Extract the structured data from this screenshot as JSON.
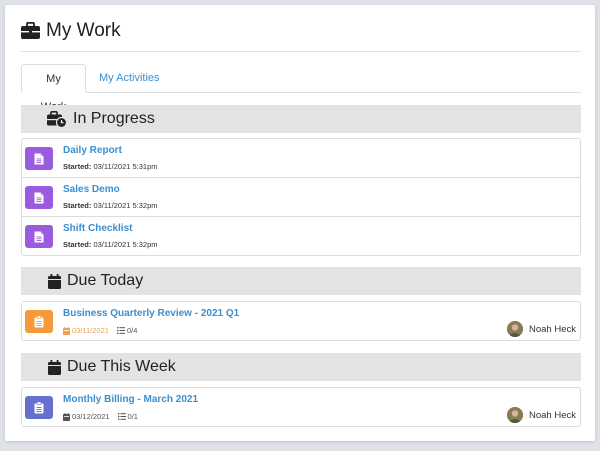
{
  "page": {
    "title": "My Work"
  },
  "tabs": [
    {
      "label": "My Work",
      "active": true
    },
    {
      "label": "My Activities",
      "active": false
    }
  ],
  "colors": {
    "link": "#3a8fd1",
    "purple_badge": "#9b5be0",
    "orange_badge": "#f5993b",
    "indigo_badge": "#6671cf",
    "overdue_date": "#f0a050"
  },
  "in_progress": {
    "title": "In Progress",
    "icon": "briefcase-clock-icon",
    "items": [
      {
        "title": "Daily Report",
        "started_label": "Started:",
        "started": "03/11/2021 5:31pm"
      },
      {
        "title": "Sales Demo",
        "started_label": "Started:",
        "started": "03/11/2021 5:32pm"
      },
      {
        "title": "Shift Checklist",
        "started_label": "Started:",
        "started": "03/11/2021 5:32pm"
      }
    ]
  },
  "due_today": {
    "title": "Due Today",
    "icon": "calendar-icon",
    "items": [
      {
        "title": "Business Quarterly Review - 2021 Q1",
        "date": "03/11/2021",
        "tasks": "0/4",
        "assignee": "Noah Heck"
      }
    ]
  },
  "due_week": {
    "title": "Due This Week",
    "icon": "calendar-icon",
    "items": [
      {
        "title": "Monthly Billing - March 2021",
        "date": "03/12/2021",
        "tasks": "0/1",
        "assignee": "Noah Heck"
      }
    ]
  }
}
